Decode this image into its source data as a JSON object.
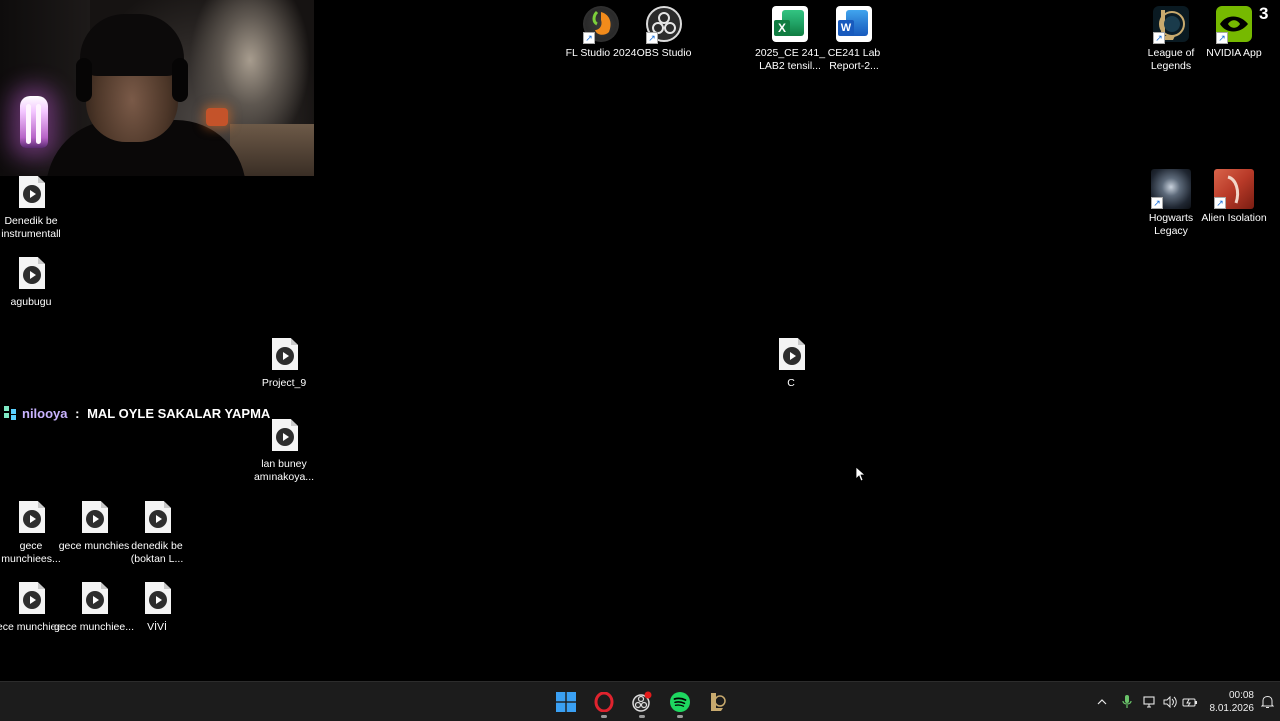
{
  "webcam": {
    "alt": "webcam feed"
  },
  "chat": {
    "username": "nilooya",
    "separator": " : ",
    "message": "MAL OYLE SAKALAR YAPMA"
  },
  "desktop_icons": {
    "fl_studio": {
      "label": "FL Studio 2024",
      "icon": "fl-studio-icon"
    },
    "obs": {
      "label": "OBS Studio",
      "icon": "obs-icon"
    },
    "excel_file": {
      "label": "2025_CE 241_ LAB2 tensil...",
      "icon": "excel-icon"
    },
    "word_file": {
      "label": "CE241 Lab Report-2...",
      "icon": "word-icon"
    },
    "league": {
      "label": "League of Legends",
      "icon": "league-icon"
    },
    "nvidia": {
      "label": "NVIDIA App",
      "icon": "nvidia-icon",
      "badge": "3"
    },
    "hogwarts": {
      "label": "Hogwarts Legacy",
      "icon": "hogwarts-icon"
    },
    "alien": {
      "label": "Alien Isolation",
      "icon": "alien-icon"
    },
    "denedik_instrumental": {
      "label": "Denedik be instrumentall",
      "icon": "video-file-icon"
    },
    "agubugu": {
      "label": "agubugu",
      "icon": "video-file-icon"
    },
    "project_9": {
      "label": "Project_9",
      "icon": "video-file-icon"
    },
    "c_file": {
      "label": "C",
      "icon": "video-file-icon"
    },
    "lan_buney": {
      "label": "lan buney amınakoya...",
      "icon": "video-file-icon"
    },
    "gece_munchiees_1": {
      "label": "gece munchiees...",
      "icon": "video-file-icon"
    },
    "gece_munchies": {
      "label": "gece munchies",
      "icon": "video-file-icon"
    },
    "denedik_boktan": {
      "label": "denedik be (boktan L...",
      "icon": "video-file-icon"
    },
    "gece_munchiee_2": {
      "label": "gece munchiee...",
      "icon": "video-file-icon"
    },
    "gece_munchiee_3": {
      "label": "gece munchiee...",
      "icon": "video-file-icon"
    },
    "vivi": {
      "label": "VİVİ",
      "icon": "video-file-icon"
    }
  },
  "taskbar": {
    "apps": [
      {
        "name": "start",
        "icon": "windows-start-icon"
      },
      {
        "name": "opera",
        "icon": "opera-icon"
      },
      {
        "name": "obs",
        "icon": "obs-recording-icon"
      },
      {
        "name": "spotify",
        "icon": "spotify-icon"
      },
      {
        "name": "league-client",
        "icon": "league-icon"
      }
    ],
    "tray": {
      "time": "00:08",
      "date": "8.01.2026"
    }
  },
  "colors": {
    "desktop_bg": "#000000",
    "taskbar_bg": "#1c1c1c",
    "chat_username": "#c9b3ff",
    "spotify_green": "#1ed760",
    "opera_red": "#e0232e",
    "start_blue": "#3aa0f3"
  }
}
